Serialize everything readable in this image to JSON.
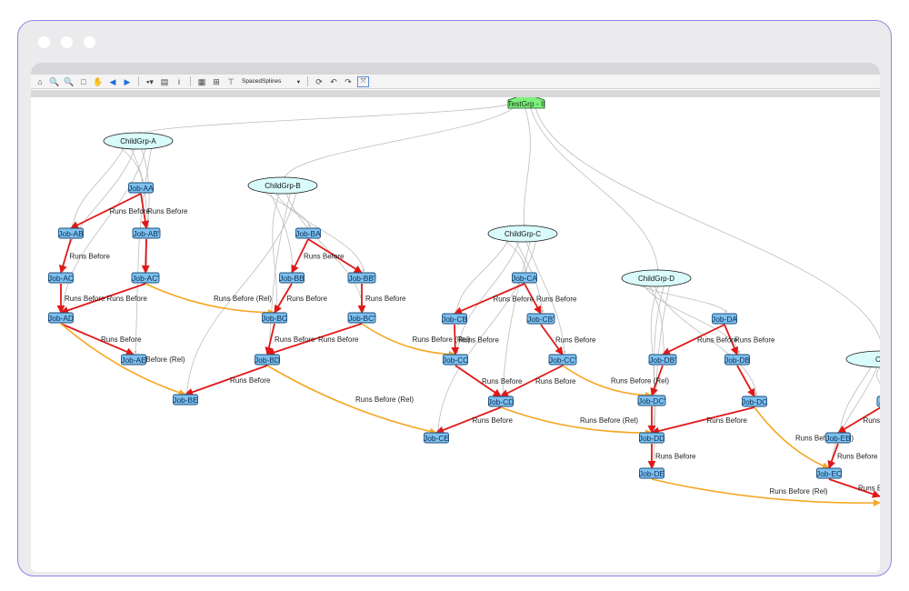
{
  "toolbar": {
    "buttons": [
      {
        "name": "home-icon",
        "glyph": "⌂"
      },
      {
        "name": "zoom-in-icon",
        "glyph": "🔍"
      },
      {
        "name": "zoom-out-icon",
        "glyph": "🔍"
      },
      {
        "name": "select-box-icon",
        "glyph": "□"
      },
      {
        "name": "pan-hand-icon",
        "glyph": "✋"
      },
      {
        "name": "back-icon",
        "glyph": "◀"
      },
      {
        "name": "forward-icon",
        "glyph": "▶"
      },
      {
        "name": "save-icon",
        "glyph": "▪▾"
      },
      {
        "name": "print-icon",
        "glyph": "▤"
      },
      {
        "name": "info-icon",
        "glyph": "i"
      },
      {
        "name": "layout-grid-icon",
        "glyph": "▦"
      },
      {
        "name": "hierarchy-icon",
        "glyph": "⊞"
      },
      {
        "name": "filter-icon",
        "glyph": "⊤"
      }
    ],
    "layout_value": "SpacedSplines",
    "right_buttons": [
      {
        "name": "refresh-layout-icon",
        "glyph": "⟳"
      },
      {
        "name": "undo-icon",
        "glyph": "↶"
      },
      {
        "name": "redo-icon",
        "glyph": "↷"
      },
      {
        "name": "fit-view-icon",
        "glyph": "⤧"
      }
    ]
  },
  "colors": {
    "runs_before": "#e01818",
    "runs_before_rel": "#f5a623",
    "grey_edge": "#bdbdbd",
    "job_fill": "#7ec0ee",
    "job_stroke": "#1f4e79",
    "group_fill": "#d9fbfc",
    "root_fill": "#7cf07c"
  },
  "labels": {
    "runs_before": "Runs Before",
    "runs_before_rel": "Runs Before (Rel)"
  },
  "graph": {
    "root": {
      "id": "root",
      "label": "TestGrp - II"
    },
    "groups": [
      {
        "id": "gA",
        "label": "ChildGrp-A"
      },
      {
        "id": "gB",
        "label": "ChildGrp-B"
      },
      {
        "id": "gC",
        "label": "ChildGrp-C"
      },
      {
        "id": "gD",
        "label": "ChildGrp-D"
      },
      {
        "id": "gE",
        "label": "Chi"
      }
    ],
    "jobs": [
      {
        "id": "AA",
        "label": "Job-AA"
      },
      {
        "id": "AB",
        "label": "Job-AB"
      },
      {
        "id": "ABp",
        "label": "Job-AB'"
      },
      {
        "id": "AC",
        "label": "Job-AC"
      },
      {
        "id": "ACp",
        "label": "Job-AC'"
      },
      {
        "id": "AD",
        "label": "Job-AD"
      },
      {
        "id": "AE",
        "label": "Job-AE"
      },
      {
        "id": "BA",
        "label": "Job-BA"
      },
      {
        "id": "BB",
        "label": "Job-BB"
      },
      {
        "id": "BBp",
        "label": "Job-BB'"
      },
      {
        "id": "BC",
        "label": "Job-BC"
      },
      {
        "id": "BCp",
        "label": "Job-BC'"
      },
      {
        "id": "BD",
        "label": "Job-BD"
      },
      {
        "id": "BE",
        "label": "Job-BE"
      },
      {
        "id": "CA",
        "label": "Job-CA"
      },
      {
        "id": "CB",
        "label": "Job-CB"
      },
      {
        "id": "CBp",
        "label": "Job-CB'"
      },
      {
        "id": "CC",
        "label": "Job-CC"
      },
      {
        "id": "CCp",
        "label": "Job-CC'"
      },
      {
        "id": "CD",
        "label": "Job-CD"
      },
      {
        "id": "CE",
        "label": "Job-CE"
      },
      {
        "id": "DA",
        "label": "Job-DA"
      },
      {
        "id": "DB",
        "label": "Job-DB"
      },
      {
        "id": "DBp",
        "label": "Job-DB'"
      },
      {
        "id": "DC",
        "label": "Job-DC"
      },
      {
        "id": "DCp",
        "label": "Job-DC'"
      },
      {
        "id": "DD",
        "label": "Job-DD"
      },
      {
        "id": "DE",
        "label": "Job-DE"
      },
      {
        "id": "EB",
        "label": "Job-EB"
      },
      {
        "id": "EC",
        "label": "Job-EC"
      },
      {
        "id": "EA",
        "label": "J"
      }
    ],
    "edges": [
      {
        "from": "AA",
        "to": "AB",
        "type": "rb",
        "label": true
      },
      {
        "from": "AA",
        "to": "ABp",
        "type": "rb",
        "label": true
      },
      {
        "from": "AB",
        "to": "AC",
        "type": "rb",
        "label": true
      },
      {
        "from": "ABp",
        "to": "ACp",
        "type": "rb",
        "label": false
      },
      {
        "from": "AC",
        "to": "AD",
        "type": "rb",
        "label": true
      },
      {
        "from": "ACp",
        "to": "AD",
        "type": "rb",
        "label": true
      },
      {
        "from": "AD",
        "to": "AE",
        "type": "rb",
        "label": true
      },
      {
        "from": "AD",
        "to": "BE",
        "type": "rel",
        "label": true
      },
      {
        "from": "ACp",
        "to": "BC",
        "type": "rel",
        "label": true
      },
      {
        "from": "BA",
        "to": "BB",
        "type": "rb",
        "label": true
      },
      {
        "from": "BA",
        "to": "BBp",
        "type": "rb",
        "label": false
      },
      {
        "from": "BB",
        "to": "BC",
        "type": "rb",
        "label": true
      },
      {
        "from": "BBp",
        "to": "BCp",
        "type": "rb",
        "label": true
      },
      {
        "from": "BC",
        "to": "BD",
        "type": "rb",
        "label": true
      },
      {
        "from": "BCp",
        "to": "BD",
        "type": "rb",
        "label": true
      },
      {
        "from": "BD",
        "to": "BE",
        "type": "rb",
        "label": true
      },
      {
        "from": "BD",
        "to": "CE",
        "type": "rel",
        "label": true
      },
      {
        "from": "BCp",
        "to": "CC",
        "type": "rel",
        "label": true
      },
      {
        "from": "CA",
        "to": "CB",
        "type": "rb",
        "label": true
      },
      {
        "from": "CA",
        "to": "CBp",
        "type": "rb",
        "label": true
      },
      {
        "from": "CB",
        "to": "CC",
        "type": "rb",
        "label": true
      },
      {
        "from": "CBp",
        "to": "CCp",
        "type": "rb",
        "label": true
      },
      {
        "from": "CC",
        "to": "CD",
        "type": "rb",
        "label": true
      },
      {
        "from": "CCp",
        "to": "CD",
        "type": "rb",
        "label": true
      },
      {
        "from": "CD",
        "to": "CE",
        "type": "rb",
        "label": true
      },
      {
        "from": "CD",
        "to": "DD",
        "type": "rel",
        "label": true
      },
      {
        "from": "CCp",
        "to": "DCp",
        "type": "rel",
        "label": true
      },
      {
        "from": "DA",
        "to": "DBp",
        "type": "rb",
        "label": true
      },
      {
        "from": "DA",
        "to": "DB",
        "type": "rb",
        "label": true
      },
      {
        "from": "DBp",
        "to": "DCp",
        "type": "rb",
        "label": false
      },
      {
        "from": "DB",
        "to": "DC",
        "type": "rb",
        "label": false
      },
      {
        "from": "DCp",
        "to": "DD",
        "type": "rb",
        "label": false
      },
      {
        "from": "DC",
        "to": "DD",
        "type": "rb",
        "label": true
      },
      {
        "from": "DD",
        "to": "DE",
        "type": "rb",
        "label": true
      },
      {
        "from": "DE",
        "to": "OFF",
        "type": "rel",
        "label": true
      },
      {
        "from": "DC",
        "to": "EC",
        "type": "rel",
        "label": true
      },
      {
        "from": "EB",
        "to": "EC",
        "type": "rb",
        "label": true
      },
      {
        "from": "EC",
        "to": "OFF2",
        "type": "rb",
        "label": true
      },
      {
        "from": "EA",
        "to": "EB",
        "type": "rb",
        "label": true
      }
    ]
  }
}
